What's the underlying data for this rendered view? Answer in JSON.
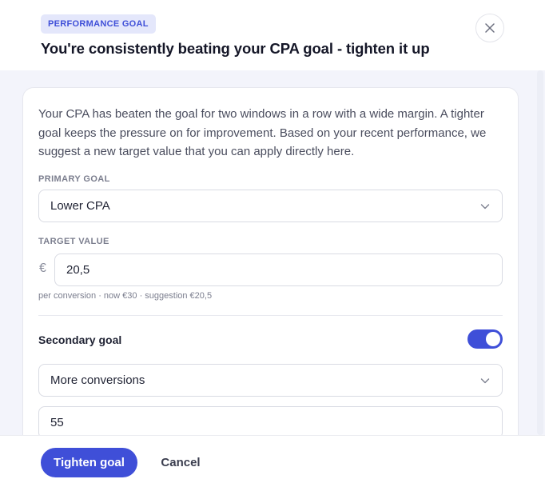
{
  "header": {
    "badge": "PERFORMANCE GOAL",
    "title": "You're consistently beating your CPA goal - tighten it up",
    "close_icon": "close-icon"
  },
  "body": {
    "description": "Your CPA has beaten the goal for two windows in a row with a wide margin. A tighter goal keeps the pressure on for improvement. Based on your recent performance, we suggest a new target value that you can apply directly here.",
    "primary_goal": {
      "label": "PRIMARY GOAL",
      "value": "Lower CPA",
      "icon": "chevron-down-icon"
    },
    "target_value": {
      "label": "TARGET VALUE",
      "currency": "€",
      "value": "20,5",
      "hint": "per conversion · now €30 · suggestion €20,5"
    },
    "secondary_goal": {
      "label": "Secondary goal",
      "enabled": true,
      "select_value": "More conversions",
      "input_value": "55",
      "icon": "chevron-down-icon"
    }
  },
  "footer": {
    "primary_label": "Tighten goal",
    "cancel_label": "Cancel"
  },
  "colors": {
    "accent": "#3f4fd8",
    "badge_bg": "#e4e7fb",
    "body_bg": "#f3f4fb"
  }
}
